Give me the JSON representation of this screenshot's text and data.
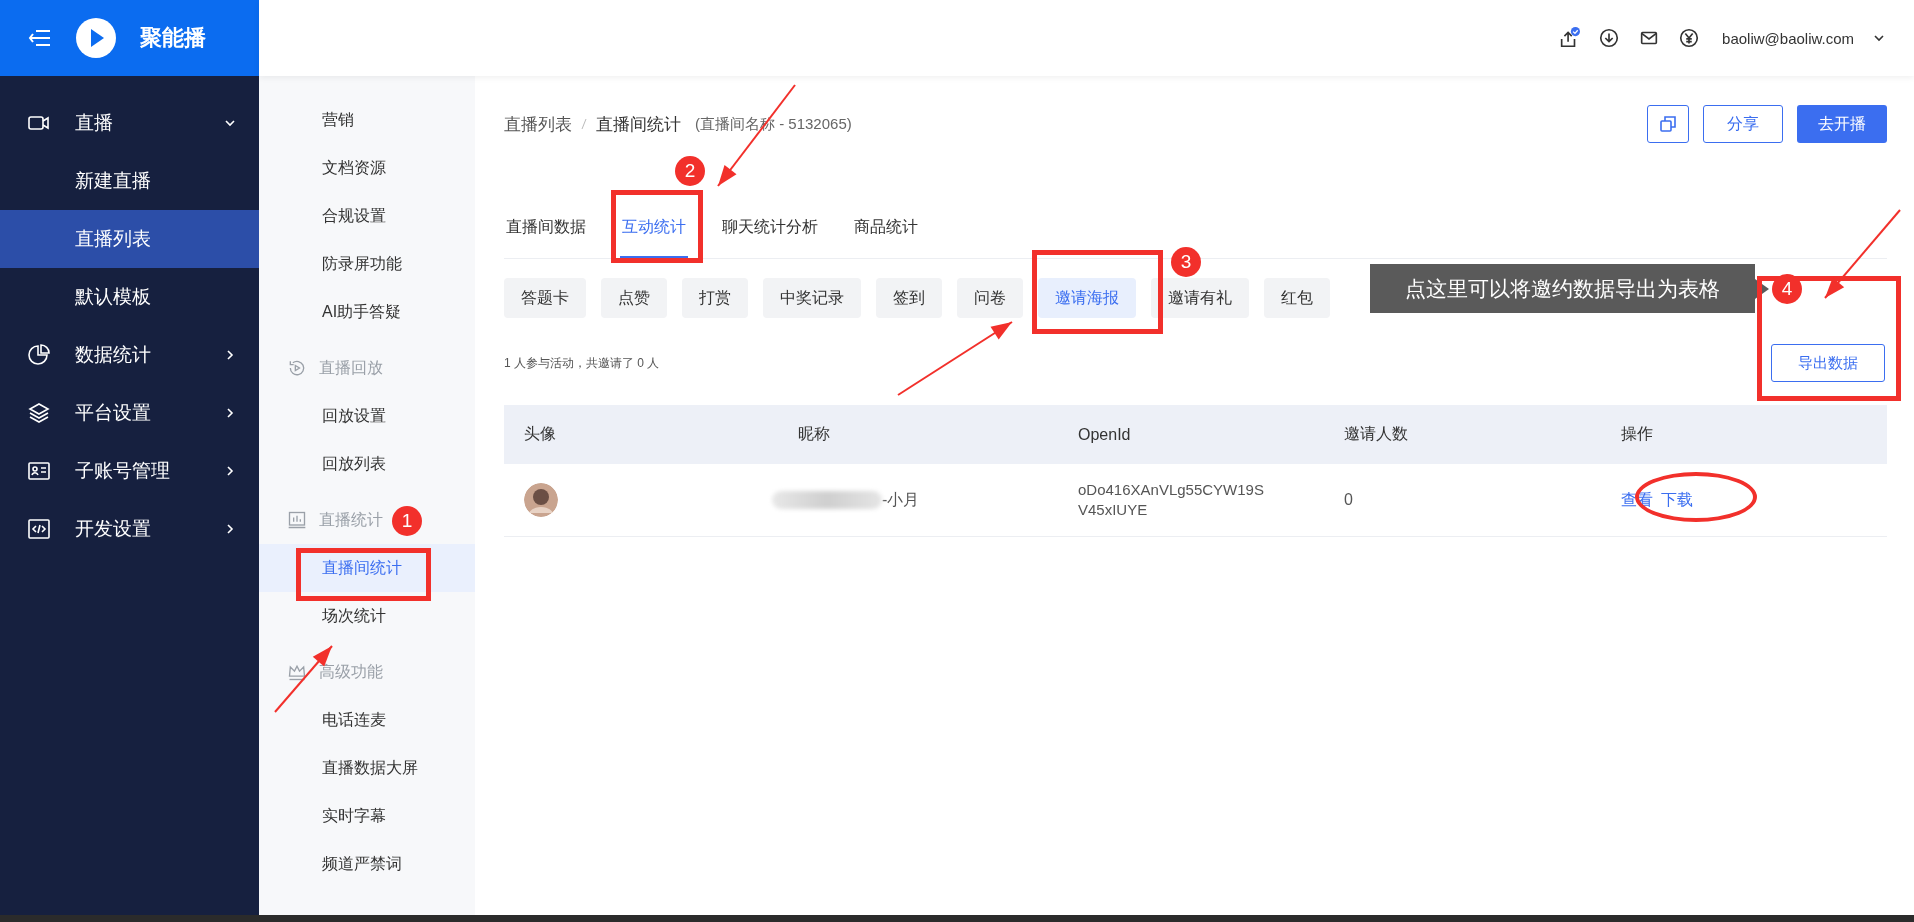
{
  "nav": {
    "brand": "聚能播",
    "items": [
      {
        "label": "直播",
        "expanded": true,
        "children": [
          {
            "label": "新建直播",
            "selected": false
          },
          {
            "label": "直播列表",
            "selected": true
          },
          {
            "label": "默认模板",
            "selected": false
          }
        ]
      },
      {
        "label": "数据统计",
        "expanded": false
      },
      {
        "label": "平台设置",
        "expanded": false
      },
      {
        "label": "子账号管理",
        "expanded": false
      },
      {
        "label": "开发设置",
        "expanded": false
      }
    ]
  },
  "subnav": {
    "sections": [
      {
        "items": [
          {
            "label": "营销",
            "selected": false
          },
          {
            "label": "文档资源",
            "selected": false
          },
          {
            "label": "合规设置",
            "selected": false
          },
          {
            "label": "防录屏功能",
            "selected": false
          },
          {
            "label": "AI助手答疑",
            "selected": false
          }
        ]
      },
      {
        "title": "直播回放",
        "items": [
          {
            "label": "回放设置",
            "selected": false
          },
          {
            "label": "回放列表",
            "selected": false
          }
        ]
      },
      {
        "title": "直播统计",
        "items": [
          {
            "label": "直播间统计",
            "selected": true
          },
          {
            "label": "场次统计",
            "selected": false
          }
        ]
      },
      {
        "title": "高级功能",
        "items": [
          {
            "label": "电话连麦",
            "selected": false
          },
          {
            "label": "直播数据大屏",
            "selected": false
          },
          {
            "label": "实时字幕",
            "selected": false
          },
          {
            "label": "频道严禁词",
            "selected": false
          }
        ]
      }
    ]
  },
  "header": {
    "user": "baoliw@baoliw.com"
  },
  "breadcrumb": [
    "直播列表",
    "直播间统计"
  ],
  "room_name": "(直播间名称 - 5132065)",
  "actions": [
    {
      "kind": "icon"
    },
    {
      "kind": "outline",
      "label": "分享"
    },
    {
      "kind": "primary",
      "label": "去开播"
    }
  ],
  "tabs": [
    {
      "label": "直播间数据",
      "selected": false
    },
    {
      "label": "互动统计",
      "selected": true
    },
    {
      "label": "聊天统计分析",
      "selected": false
    },
    {
      "label": "商品统计",
      "selected": false
    }
  ],
  "chips": [
    {
      "label": "答题卡",
      "selected": false
    },
    {
      "label": "点赞",
      "selected": false
    },
    {
      "label": "打赏",
      "selected": false
    },
    {
      "label": "中奖记录",
      "selected": false
    },
    {
      "label": "签到",
      "selected": false
    },
    {
      "label": "问卷",
      "selected": false
    },
    {
      "label": "邀请海报",
      "selected": true
    },
    {
      "label": "邀请有礼",
      "selected": false
    },
    {
      "label": "红包",
      "selected": false
    }
  ],
  "summary": "1 人参与活动，共邀请了 0 人",
  "export_button": "导出数据",
  "table": {
    "columns": [
      "头像",
      "昵称",
      "OpenId",
      "邀请人数",
      "操作"
    ],
    "rows": [
      {
        "nickname": "-小月",
        "openid": "oDo416XAnVLg55CYW19SV45xIUYE",
        "invited": "0",
        "actions": [
          "查看",
          "下载"
        ]
      }
    ]
  },
  "tooltip": "点这里可以将邀约数据导出为表格",
  "markers": [
    "1",
    "2",
    "3",
    "4"
  ]
}
